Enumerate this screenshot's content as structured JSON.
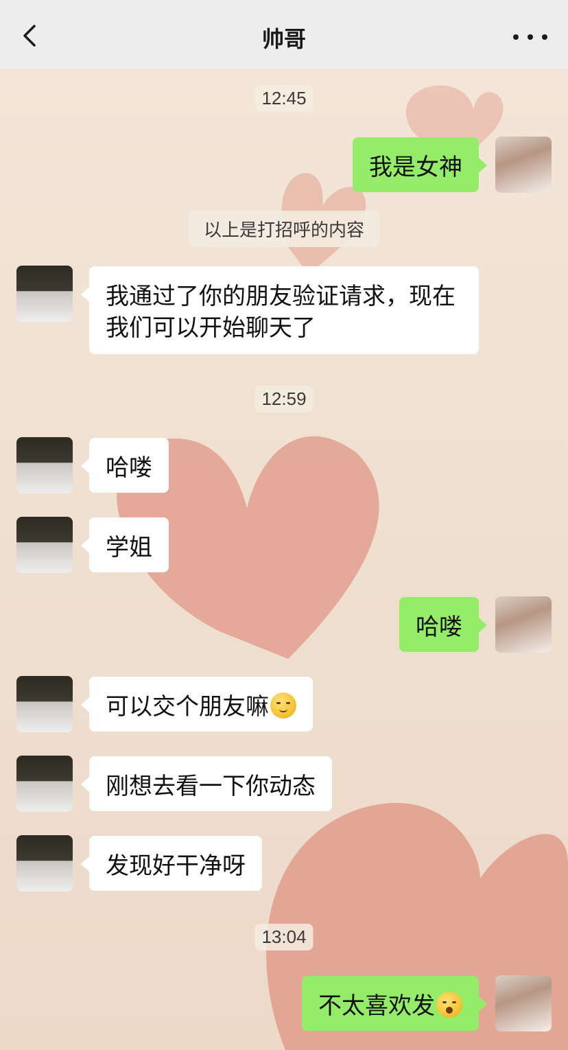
{
  "header": {
    "title": "帅哥",
    "back_icon": "chevron-left-icon",
    "more_icon": "ellipsis-icon"
  },
  "colors": {
    "outgoing_bubble": "#95ec69",
    "incoming_bubble": "#ffffff",
    "header_bg": "#ededed",
    "heart": "#e2a090"
  },
  "messages": {
    "t1": "12:45",
    "m1": "我是女神",
    "sys1": "以上是打招呼的内容",
    "m2_line1": "我通过了你的朋友验证请求，现在",
    "m2_line2": "我们可以开始聊天了",
    "t2": "12:59",
    "m3": "哈喽",
    "m4": "学姐",
    "m5": "哈喽",
    "m6": "可以交个朋友嘛",
    "m6_emoji": "blush-emoji",
    "m7": "刚想去看一下你动态",
    "m8": "发现好干净呀",
    "t3": "13:04",
    "m9": "不太喜欢发",
    "m9_emoji": "awkward-emoji"
  }
}
